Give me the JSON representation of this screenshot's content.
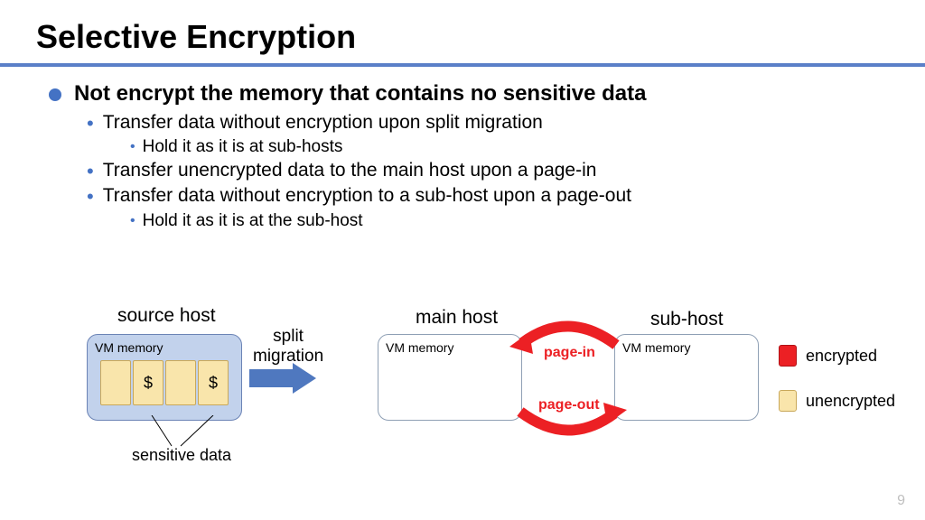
{
  "title": "Selective Encryption",
  "bullets": {
    "l1": "Not encrypt the memory that contains no sensitive data",
    "l2a": "Transfer data without encryption upon split migration",
    "l3a": "Hold it as it is at sub-hosts",
    "l2b": "Transfer unencrypted data to the main host upon a page-in",
    "l2c": "Transfer data without encryption to a sub-host upon a page-out",
    "l3b": "Hold it as it is at the sub-host"
  },
  "diagram": {
    "source_host": "source host",
    "main_host": "main host",
    "sub_host": "sub-host",
    "vm_memory": "VM memory",
    "split_migration": "split\nmigration",
    "page_in": "page-in",
    "page_out": "page-out",
    "sensitive_data": "sensitive data",
    "cell_symbol": "$",
    "legend_encrypted": "encrypted",
    "legend_unencrypted": "unencrypted"
  },
  "page_number": "9"
}
